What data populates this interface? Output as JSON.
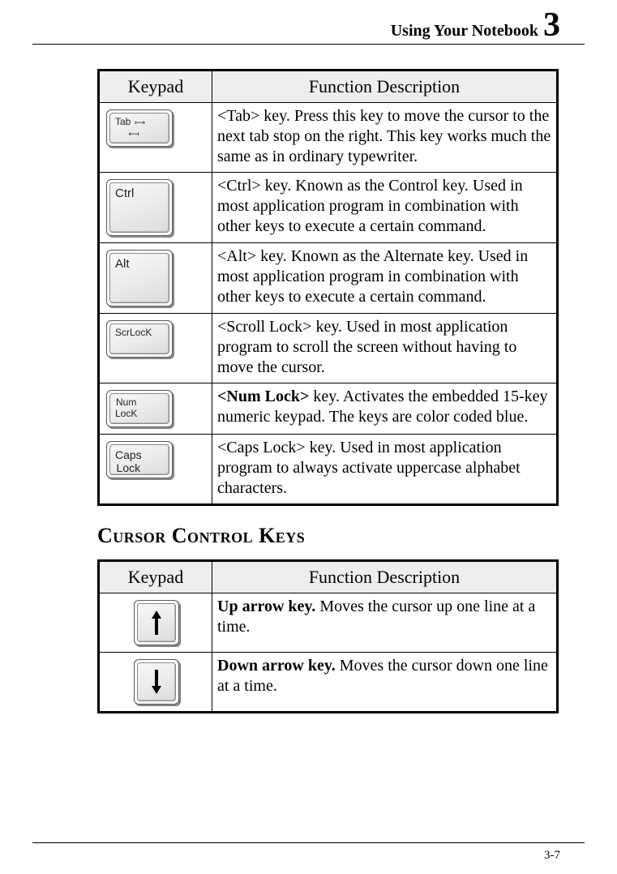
{
  "header": {
    "title": "Using Your Notebook",
    "chapter_number": "3"
  },
  "table1": {
    "headers": {
      "keypad": "Keypad",
      "desc": "Function Description"
    },
    "rows": [
      {
        "label": "Tab",
        "desc_pre": "<Tab>",
        "desc_rest": " key. Press this key to move the cursor to the next tab stop on the right. This key works much the same as in ordinary typewriter."
      },
      {
        "label": "Ctrl",
        "desc_pre": "<Ctrl>",
        "desc_rest": " key. Known as the Control key. Used in most application program in combination with other keys to execute a certain command."
      },
      {
        "label": "Alt",
        "desc_pre": "<Alt>",
        "desc_rest": " key. Known as the Alternate key. Used in most application program in combination with other keys to execute a certain command."
      },
      {
        "label": "ScrLocK",
        "desc_pre": "<Scroll Lock>",
        "desc_rest": " key. Used in most application program to scroll the screen without having to move the cursor."
      },
      {
        "label_line1": "Num",
        "label_line2": "LocK",
        "desc_bold": "<Num Lock>",
        "desc_rest": " key. Activates the embedded 15-key numeric keypad. The keys are color coded blue."
      },
      {
        "label_line1": "Caps",
        "label_line2": "Lock",
        "desc_pre": "<Caps Lock>",
        "desc_rest": " key. Used in most application program to always activate uppercase alphabet characters."
      }
    ]
  },
  "section_heading": "Cursor Control Keys",
  "table2": {
    "headers": {
      "keypad": "Keypad",
      "desc": "Function Description"
    },
    "rows": [
      {
        "desc_bold": "Up arrow key.",
        "desc_rest": " Moves the cursor up one line at a time."
      },
      {
        "desc_bold": "Down arrow key.",
        "desc_rest": " Moves the cursor down one line at a time."
      }
    ]
  },
  "footer": {
    "page": "3-7"
  }
}
